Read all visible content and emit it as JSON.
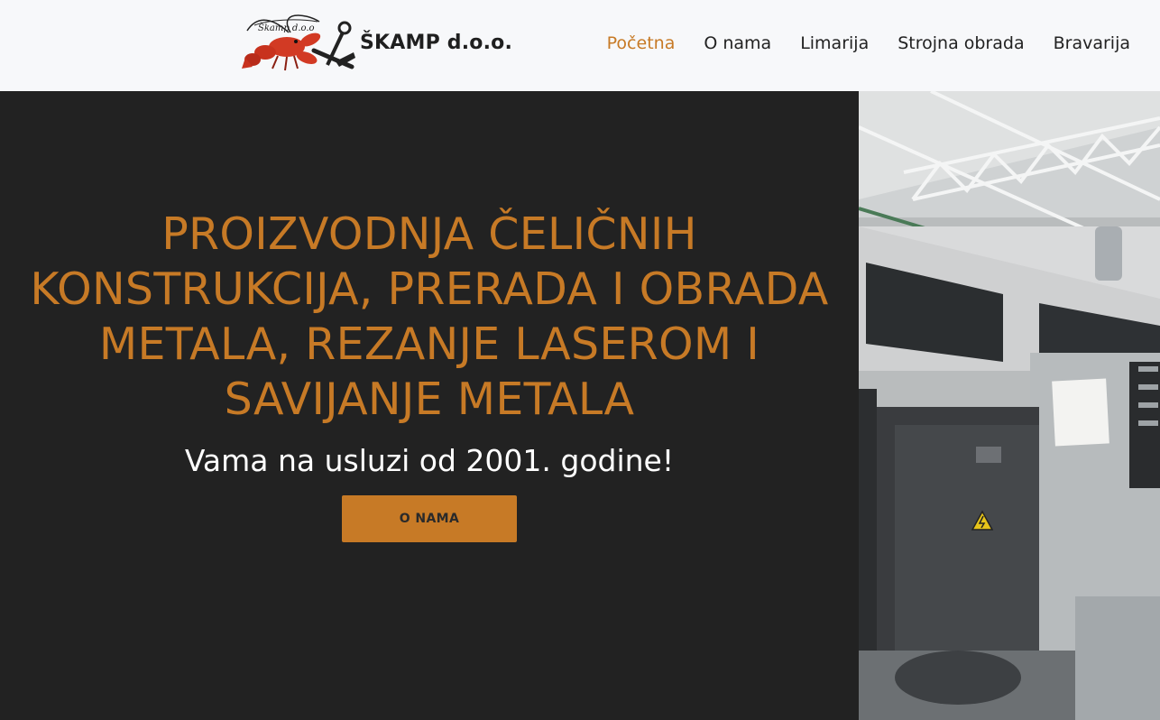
{
  "header": {
    "brand_name": "ŠKAMP d.o.o.",
    "logo_alt": "Škamp d.o.o. lobster logo"
  },
  "nav": {
    "items": [
      {
        "label": "Početna",
        "active": true
      },
      {
        "label": "O nama",
        "active": false
      },
      {
        "label": "Limarija",
        "active": false
      },
      {
        "label": "Strojna obrada",
        "active": false
      },
      {
        "label": "Bravarija",
        "active": false
      }
    ]
  },
  "hero": {
    "title": "PROIZVODNJA ČELIČNIH KONSTRUKCIJA, PRERADA I OBRADA METALA, REZANJE LASEROM I SAVIJANJE METALA",
    "subtitle": "Vama na usluzi od 2001. godine!",
    "button_label": "O NAMA"
  },
  "colors": {
    "accent": "#c77a26",
    "dark_bg": "#222222",
    "header_bg": "#f7f8fa"
  },
  "icons": {
    "logo": "lobster-logo-icon",
    "warning": "electrical-warning-icon"
  }
}
